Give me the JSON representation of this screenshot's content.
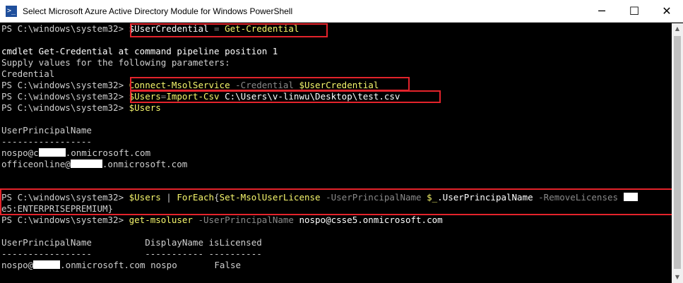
{
  "window": {
    "title": "Select Microsoft Azure Active Directory Module for Windows PowerShell",
    "icon_glyph": ">_",
    "minimize_glyph": "─",
    "maximize_glyph": "☐",
    "close_glyph": "✕"
  },
  "console": {
    "prompt": "PS C:\\windows\\system32> ",
    "l1": {
      "var": "$UserCredential",
      "op": " = ",
      "cmd": "Get-Credential"
    },
    "l3": "cmdlet Get-Credential at command pipeline position 1",
    "l4": "Supply values for the following parameters:",
    "l5": "Credential",
    "l6": {
      "cmd": "Connect-MsolService",
      "param": " -Credential ",
      "var": "$UserCredential"
    },
    "l7": {
      "var": "$Users",
      "op": "=",
      "cmd": "Import-Csv",
      "arg": " C:\\Users\\v-linwu\\Desktop\\test.csv"
    },
    "l8": {
      "var": "$Users"
    },
    "l10": "UserPrincipalName",
    "l11": "-----------------",
    "l12": {
      "pre": "nospo@c",
      "post": ".onmicrosoft.com"
    },
    "l13": {
      "pre": "officeonline@",
      "post": ".onmicrosoft.com"
    },
    "l17": {
      "var": "$Users",
      "pipe": " | ",
      "cmd1": "ForEach",
      "brace": "{",
      "cmd2": "Set-MsolUserLicense",
      "p1": " -UserPrincipalName ",
      "v2": "$_",
      "prop": ".UserPrincipalName",
      "p2": " -RemoveLicenses "
    },
    "l18": "e5:ENTERPRISEPREMIUM}",
    "l19": {
      "cmd": "get-msoluser",
      "param": " -UserPrincipalName ",
      "arg": "nospo@csse5.onmicrosoft.com"
    },
    "l21": "UserPrincipalName          DisplayName isLicensed",
    "l22": "-----------------          ----------- ----------",
    "l23": {
      "pre": "nospo@",
      "post": ".onmicrosoft.com nospo       False"
    }
  },
  "scrollbar": {
    "up_glyph": "▲",
    "down_glyph": "▼"
  },
  "colors": {
    "background": "#000000",
    "text": "#cfcfcf",
    "command": "#f6f66c",
    "parameter": "#8a8a8a",
    "highlight_box": "#e3232b"
  }
}
